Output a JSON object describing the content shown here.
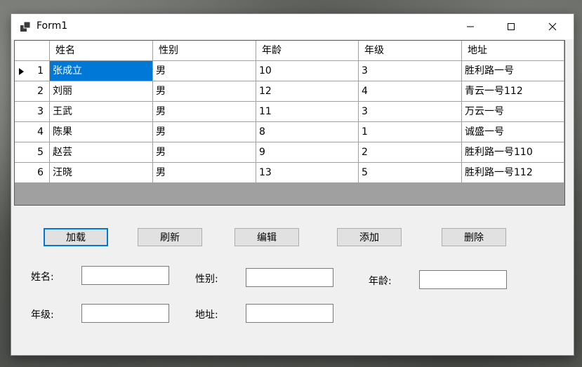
{
  "window": {
    "title": "Form1",
    "icon": "winforms-app-icon"
  },
  "grid": {
    "columns": [
      "姓名",
      "性别",
      "年龄",
      "年级",
      "地址"
    ],
    "rows": [
      {
        "num": "1",
        "cells": [
          "张成立",
          "男",
          "10",
          "3",
          "胜利路一号"
        ],
        "current": true
      },
      {
        "num": "2",
        "cells": [
          "刘丽",
          "男",
          "12",
          "4",
          "青云一号112"
        ]
      },
      {
        "num": "3",
        "cells": [
          "王武",
          "男",
          "11",
          "3",
          "万云一号"
        ]
      },
      {
        "num": "4",
        "cells": [
          "陈果",
          "男",
          "8",
          "1",
          "诚盛一号"
        ]
      },
      {
        "num": "5",
        "cells": [
          "赵芸",
          "男",
          "9",
          "2",
          "胜利路一号110"
        ]
      },
      {
        "num": "6",
        "cells": [
          "汪晓",
          "男",
          "13",
          "5",
          "胜利路一号112"
        ]
      }
    ]
  },
  "buttons": {
    "load": "加载",
    "refresh": "刷新",
    "edit": "编辑",
    "add": "添加",
    "delete": "删除"
  },
  "form": {
    "name_label": "姓名:",
    "gender_label": "性别:",
    "age_label": "年龄:",
    "grade_label": "年级:",
    "address_label": "地址:",
    "name_value": "",
    "gender_value": "",
    "age_value": "",
    "grade_value": "",
    "address_value": ""
  },
  "colors": {
    "selection": "#0078d7",
    "grid_background": "#a0a0a0",
    "window": "#f0f0f0"
  }
}
